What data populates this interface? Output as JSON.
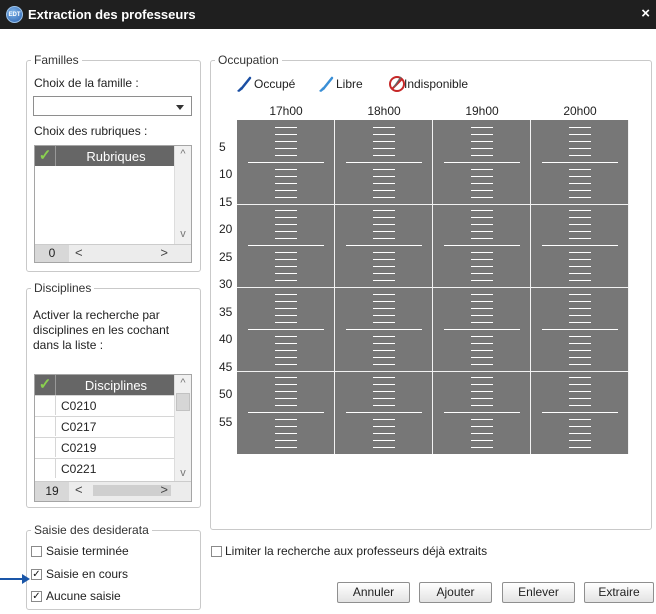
{
  "window": {
    "title": "Extraction des professeurs",
    "app_icon_text": "EDT",
    "close_glyph": "×"
  },
  "familles": {
    "legend": "Familles",
    "choix_famille_label": "Choix de la famille :",
    "famille_value": "",
    "choix_rubriques_label": "Choix des rubriques :",
    "rubriques_header": "Rubriques",
    "rubriques_count": "0",
    "scroll_left": "<",
    "scroll_right": ">"
  },
  "disciplines": {
    "legend": "Disciplines",
    "instructions": [
      "Activer la recherche par",
      "disciplines en les cochant",
      "dans la liste :"
    ],
    "header": "Disciplines",
    "items": [
      "C0210",
      "C0217",
      "C0219",
      "C0221"
    ],
    "count": "19",
    "scroll_left": "<",
    "scroll_right": ">"
  },
  "saisie": {
    "legend": "Saisie des desiderata",
    "options": [
      {
        "label": "Saisie terminée",
        "checked": false
      },
      {
        "label": "Saisie en cours",
        "checked": true
      },
      {
        "label": "Aucune saisie",
        "checked": true
      }
    ]
  },
  "occupation": {
    "legend": "Occupation",
    "tools": [
      {
        "label": "Occupé",
        "icon": "brush-occupied-icon"
      },
      {
        "label": "Libre",
        "icon": "brush-free-icon"
      },
      {
        "label": "Indisponible",
        "icon": "unavailable-icon"
      }
    ],
    "hours": [
      "17h00",
      "18h00",
      "19h00",
      "20h00"
    ],
    "minutes": [
      "5",
      "10",
      "15",
      "20",
      "25",
      "30",
      "35",
      "40",
      "45",
      "50",
      "55"
    ],
    "grid_color": "#777777"
  },
  "limit_checkbox": {
    "label": "Limiter la recherche aux professeurs déjà extraits",
    "checked": false
  },
  "buttons": {
    "annuler": "Annuler",
    "ajouter": "Ajouter",
    "enlever": "Enlever",
    "extraire": "Extraire"
  },
  "colors": {
    "titlebar": "#1f1f1f",
    "check_green": "#8ad04f",
    "pointer_blue": "#1a56a8"
  }
}
